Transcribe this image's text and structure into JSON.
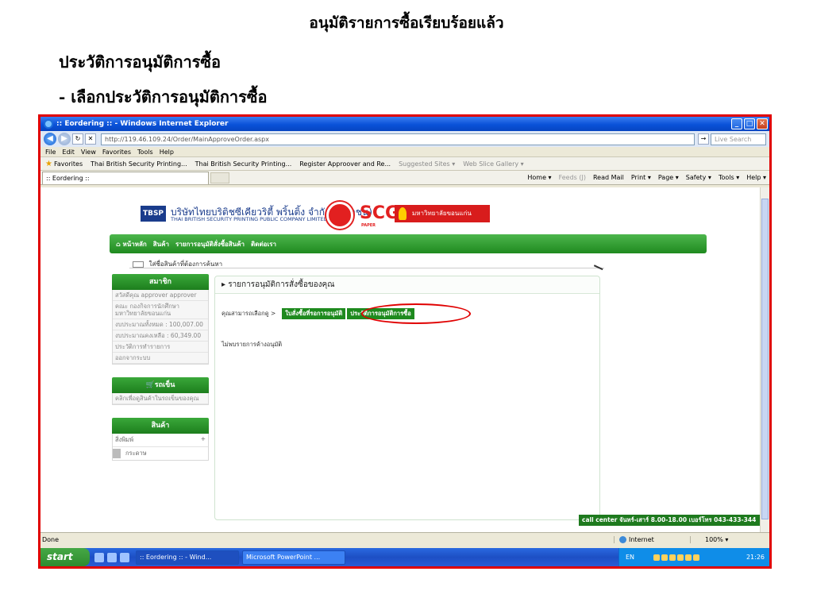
{
  "doc": {
    "title": "อนุมัติรายการซื้อเรียบร้อยแล้ว",
    "heading": "ประวัติการอนุมัติการซื้อ",
    "bullet": "-  เลือกประวัติการอนุมัติการซื้อ"
  },
  "window": {
    "title": ":: Eordering :: - Windows Internet Explorer",
    "address": "http://119.46.109.24/Order/MainApproveOrder.aspx",
    "search_placeholder": "Live Search",
    "menu": [
      "File",
      "Edit",
      "View",
      "Favorites",
      "Tools",
      "Help"
    ],
    "favorites_label": "Favorites",
    "favorites": [
      "Thai British Security Printing...",
      "Thai British Security Printing...",
      "Register Approover and Re...",
      "Suggested Sites ▾",
      "Web Slice Gallery ▾"
    ],
    "tab_title": ":: Eordering ::",
    "commands": [
      "Home ▾",
      "Feeds (J)",
      "Read Mail",
      "Print ▾",
      "Page ▾",
      "Safety ▾",
      "Tools ▾",
      "Help ▾"
    ]
  },
  "site": {
    "logo": "TBSP",
    "company_th": "บริษัทไทยบริติชซีเคียวริตี้ พริ้นติ้ง จำกัด (มหาชน)",
    "company_en": "THAI BRITISH SECURITY PRINTING PUBLIC COMPANY LIMITED",
    "scg": "SCG",
    "scg_sub": "PAPER",
    "partner": "มหาวิทยาลัยขอนแก่น",
    "nav": [
      "⌂ หน้าหลัก",
      "สินค้า",
      "รายการอนุมัติสั่งซื้อสินค้า",
      "ติดต่อเรา"
    ],
    "search_placeholder": "ใส่ชื่อสินค้าที่ต้องการค้นหา"
  },
  "sidebar": {
    "member_head": "สมาชิก",
    "member_items": [
      "สวัสดีคุณ approver approver",
      "คณะ กองกิจการนักศึกษา มหาวิทยาลัยขอนแก่น",
      "งบประมาณทั้งหมด : 100,007.00",
      "งบประมาณคงเหลือ : 60,349.00",
      "ประวัติการทำรายการ",
      "ออกจากระบบ"
    ],
    "cart_head": "🛒รถเข็น",
    "cart_item": "คลิกเพื่อดูสินค้าในรถเข็นของคุณ",
    "product_head": "สินค้า",
    "product_cat": "สิ่งพิมพ์",
    "product_sub": "กระดาษ"
  },
  "panel": {
    "title": "▸ รายการอนุมัติการสั่งซื้อของคุณ",
    "choose_label": "คุณสามารถเลือกดู >",
    "btn_pending": "ใบสั่งซื้อที่รอการอนุมัติ",
    "btn_history": "ประวัติการอนุมัติการซื้อ",
    "message": "ไม่พบรายการค้างอนุมัติ"
  },
  "callcenter": "call center จันทร์-เสาร์ 8.00-18.00 เบอร์โทร 043-433-344",
  "status": {
    "text": "Done",
    "zone": "Internet",
    "zoom": "100% ▾"
  },
  "taskbar": {
    "start": "start",
    "items": [
      ":: Eordering :: - Wind...",
      "Microsoft PowerPoint ..."
    ],
    "lang": "EN",
    "clock": "21:26"
  }
}
